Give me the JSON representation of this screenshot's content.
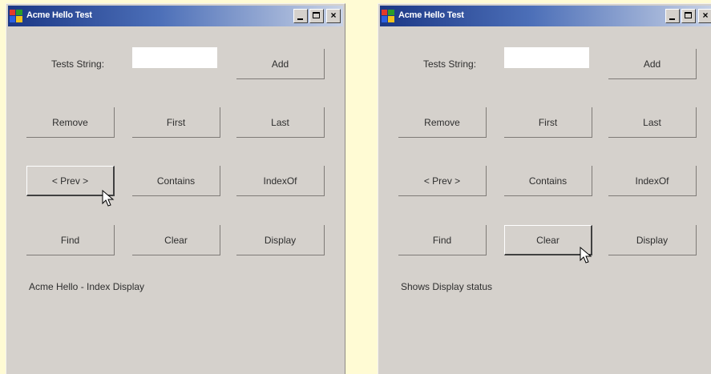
{
  "windows": [
    {
      "title": "Acme Hello Test",
      "caption_buttons": {
        "minimize": "_",
        "maximize": "□",
        "close": "×"
      },
      "field_label": "Tests String:",
      "field_value": "",
      "buttons": {
        "r0c2": "Add",
        "r1c0": "Remove",
        "r1c1": "First",
        "r1c2": "Last",
        "r2c0": "< Prev >",
        "r2c1": "Contains",
        "r2c2": "IndexOf",
        "r3c0": "Find",
        "r3c1": "Clear",
        "r3c2": "Display"
      },
      "status_text": "Acme Hello - Index Display"
    },
    {
      "title": "Acme Hello Test",
      "caption_buttons": {
        "minimize": "_",
        "maximize": "□",
        "close": "×"
      },
      "field_label": "Tests String:",
      "field_value": "",
      "buttons": {
        "r0c2": "Add",
        "r1c0": "Remove",
        "r1c1": "First",
        "r1c2": "Last",
        "r2c0": "< Prev >",
        "r2c1": "Contains",
        "r2c2": "IndexOf",
        "r3c0": "Find",
        "r3c1": "Clear",
        "r3c2": "Display"
      },
      "status_text": "Shows Display status"
    }
  ]
}
